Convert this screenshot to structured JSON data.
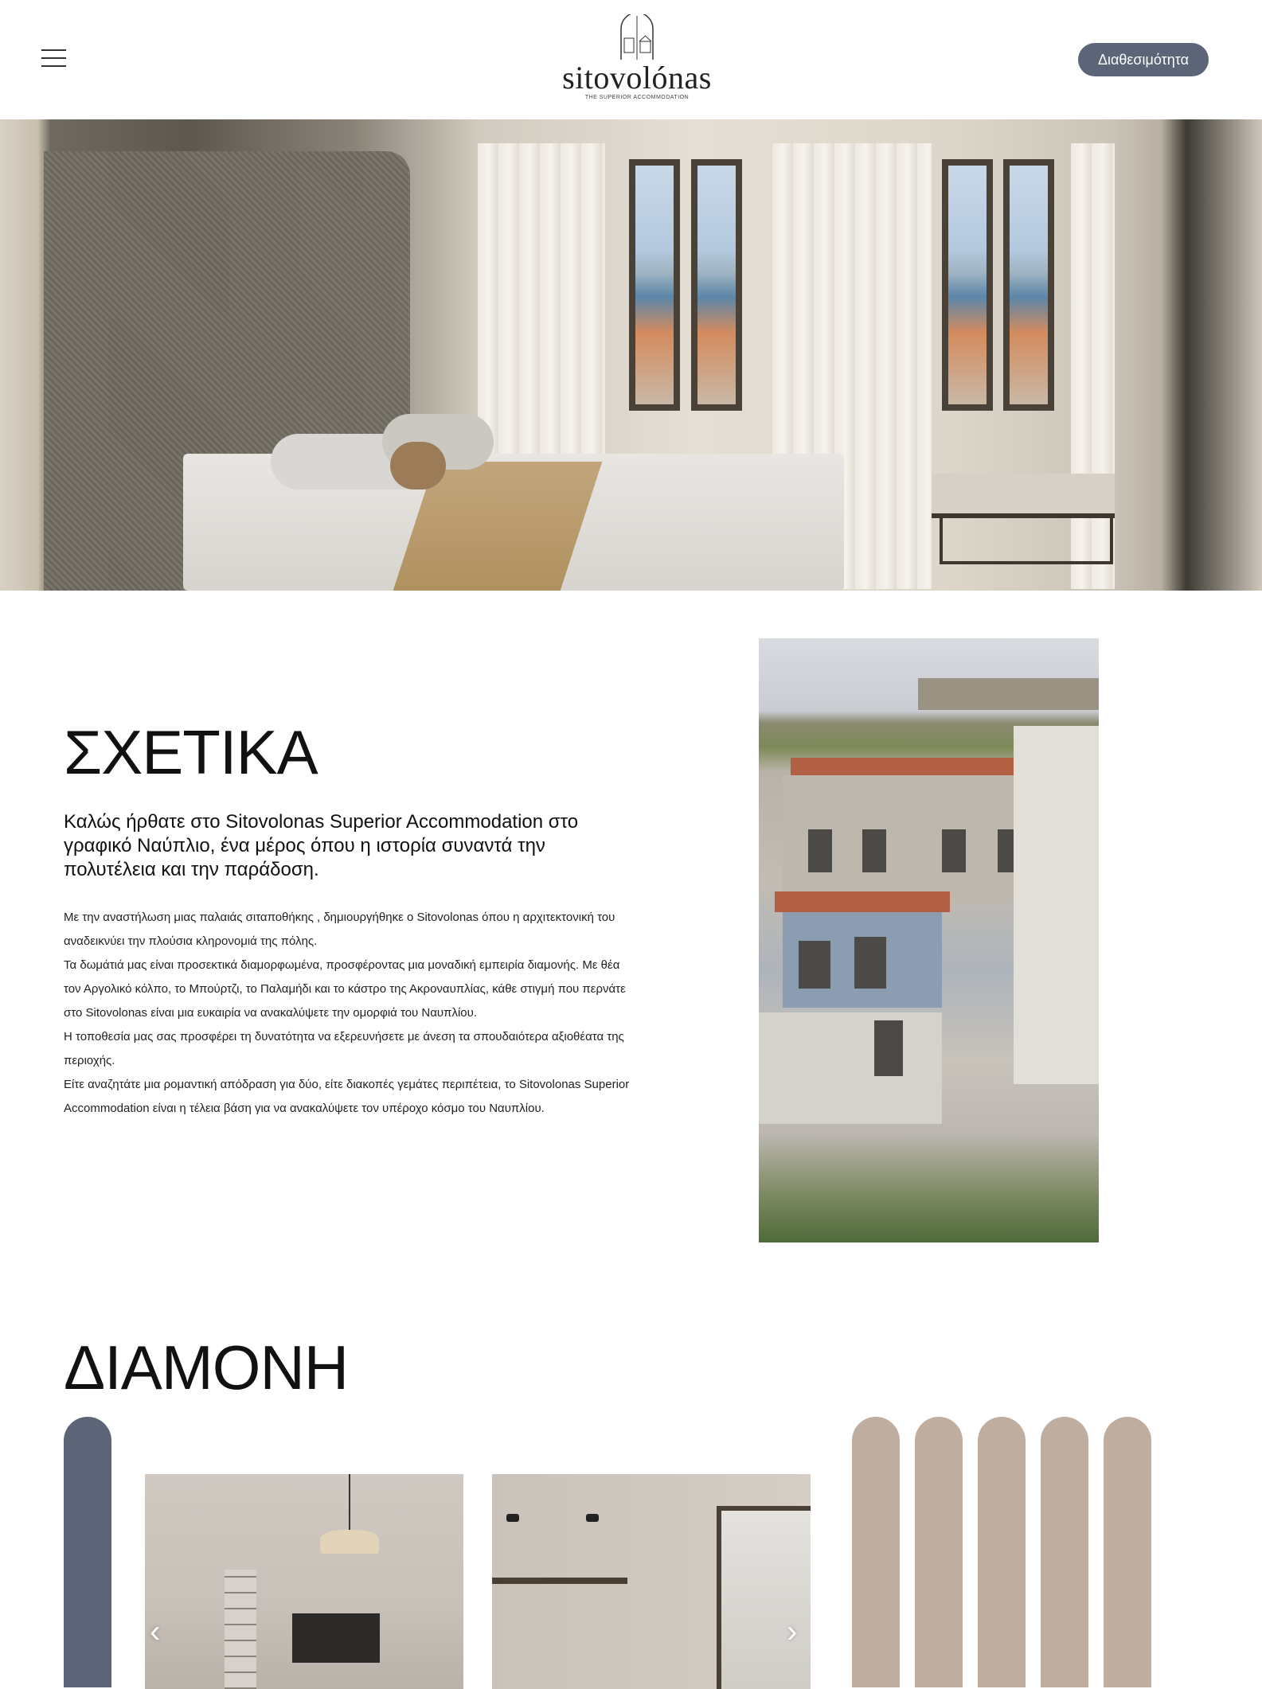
{
  "header": {
    "logo_word": "sitovolónas",
    "logo_tagline": "THE SUPERIOR ACCOMMODATION",
    "availability_label": "Διαθεσιμότητα"
  },
  "hero": {
    "image_alt": "Bedroom with sea view"
  },
  "about": {
    "title": "ΣΧΕΤΙΚΑ",
    "lead": "Καλώς ήρθατε στο Sitovolonas Superior Accommodation στο γραφικό Ναύπλιο, ένα μέρος όπου η ιστορία συναντά την πολυτέλεια και την παράδοση.",
    "paragraphs": [
      "Με την αναστήλωση μιας παλαιάς σιταποθήκης , δημιουργήθηκε ο Sitovolonas όπου η αρχιτεκτονική του αναδεικνύει την πλούσια κληρονομιά της πόλης.",
      "Τα δωμάτιά μας είναι προσεκτικά διαμορφωμένα, προσφέροντας μια μοναδική εμπειρία διαμονής. Με θέα τον Αργολικό κόλπο, το Μπούρτζι, το Παλαμήδι και το κάστρο της Ακροναυπλίας, κάθε στιγμή που περνάτε στο Sitovolonas είναι μια ευκαιρία να ανακαλύψετε την ομορφιά του Ναυπλίου.",
      "Η τοποθεσία μας σας προσφέρει τη δυνατότητα να εξερευνήσετε με άνεση τα σπουδαιότερα αξιοθέατα της περιοχής.",
      "Είτε αναζητάτε μια ρομαντική απόδραση για δύο, είτε διακοπές γεμάτες περιπέτεια, το Sitovolonas Superior Accommodation είναι η τέλεια βάση για να ανακαλύψετε τον υπέροχο κόσμο του Ναυπλίου."
    ]
  },
  "stay": {
    "title": "ΔΙΑΜΟΝΗ",
    "prev_arrow": "‹",
    "next_arrow": "›"
  },
  "colors": {
    "accent_slate": "#5b6577",
    "accent_sand": "#bfada0"
  }
}
